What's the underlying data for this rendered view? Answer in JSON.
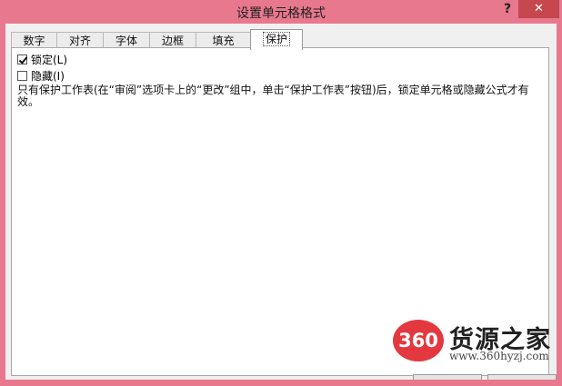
{
  "window": {
    "title": "设置单元格格式",
    "help_label": "?",
    "close_label": "✕"
  },
  "tabs": [
    {
      "label": "数字",
      "active": false
    },
    {
      "label": "对齐",
      "active": false
    },
    {
      "label": "字体",
      "active": false
    },
    {
      "label": "边框",
      "active": false
    },
    {
      "label": "填充",
      "active": false
    },
    {
      "label": "保护",
      "active": true
    }
  ],
  "protection": {
    "locked": {
      "label": "锁定(L)",
      "checked": true
    },
    "hidden": {
      "label": "隐藏(I)",
      "checked": false
    },
    "description": "只有保护工作表(在“审阅”选项卡上的“更改”组中，单击“保护工作表”按钮)后，锁定单元格或隐藏公式才有效。"
  },
  "watermark": {
    "logo_text": "360",
    "title": "货源之家",
    "url": "www.360hyzj.com"
  },
  "colors": {
    "titlebar": "#e8788e",
    "close_button": "#c7474f",
    "watermark_logo": "#e3383f"
  }
}
